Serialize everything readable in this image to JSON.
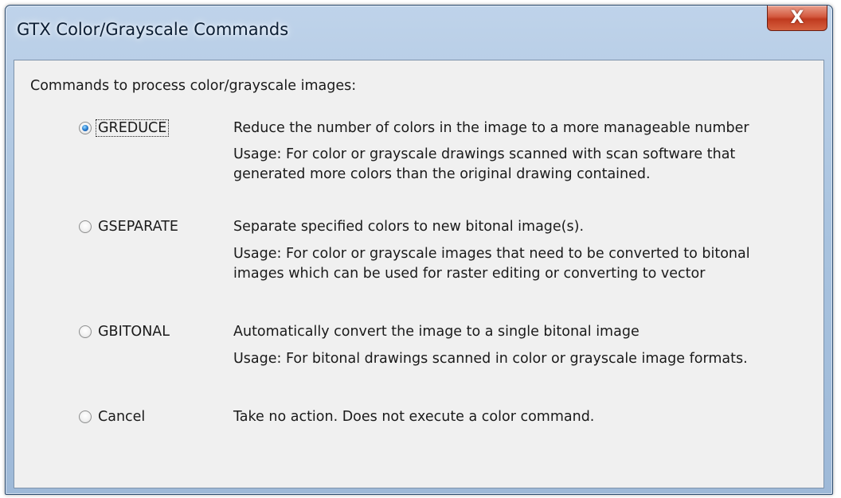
{
  "window": {
    "title": "GTX Color/Grayscale Commands",
    "close_symbol": "X"
  },
  "intro": "Commands to process color/grayscale images:",
  "options": [
    {
      "label": "GREDUCE",
      "selected": true,
      "description": "Reduce the number of colors in the image to a more manageable number",
      "usage_lines": [
        "Usage:   For color or grayscale drawings scanned with scan software that",
        "generated more colors than the original drawing contained."
      ]
    },
    {
      "label": "GSEPARATE",
      "selected": false,
      "description": "Separate specified colors to new bitonal image(s).",
      "usage_lines": [
        "Usage:    For color or grayscale images that need to be converted to bitonal",
        "images  which can be used for raster editing or converting to vector"
      ]
    },
    {
      "label": "GBITONAL",
      "selected": false,
      "description": "Automatically convert the image to a single bitonal image",
      "usage_lines": [
        "Usage:  For bitonal drawings scanned in color or grayscale image formats."
      ]
    },
    {
      "label": "Cancel",
      "selected": false,
      "description": "Take no action.  Does not execute a color command.",
      "usage_lines": []
    }
  ]
}
